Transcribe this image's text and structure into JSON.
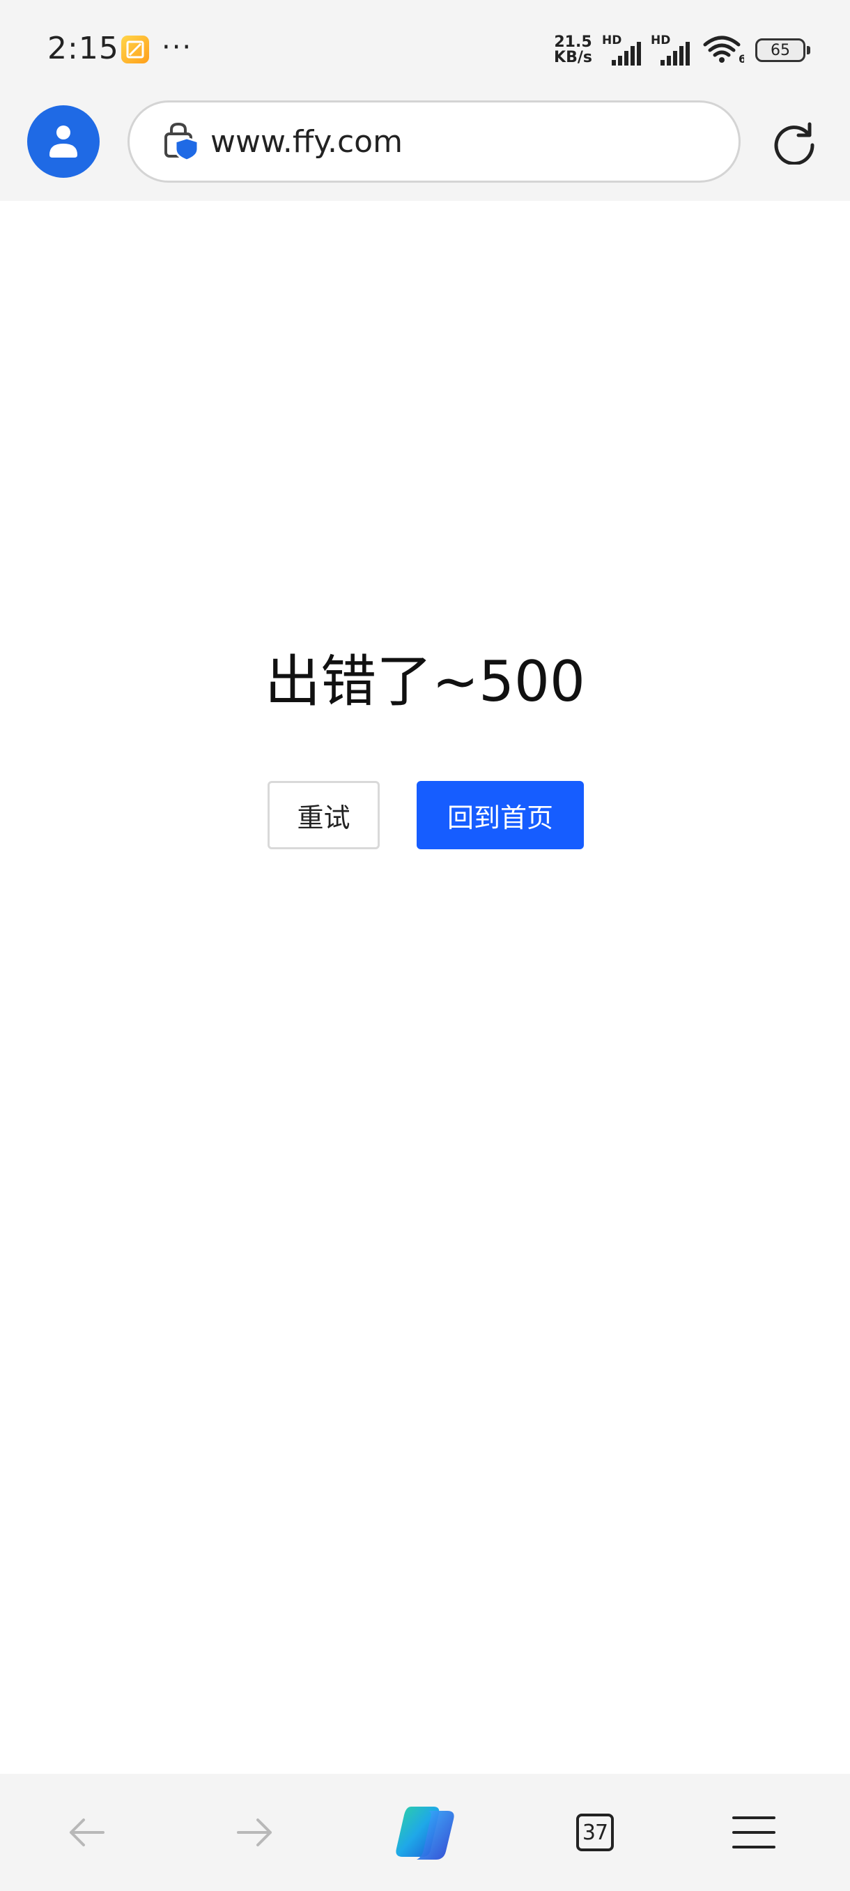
{
  "status_bar": {
    "time": "2:15",
    "more": "···",
    "net_speed_value": "21.5",
    "net_speed_unit": "KB/s",
    "signal_1_label": "HD",
    "signal_2_label": "HD",
    "wifi_label": "6",
    "battery": "65"
  },
  "address_bar": {
    "url": "www.ffy.com"
  },
  "page": {
    "error_title": "出错了~500",
    "retry_label": "重试",
    "home_label": "回到首页"
  },
  "bottom_nav": {
    "tab_count": "37"
  },
  "colors": {
    "accent": "#165dff",
    "avatar": "#1f6ae5",
    "chrome": "#f4f4f4"
  }
}
